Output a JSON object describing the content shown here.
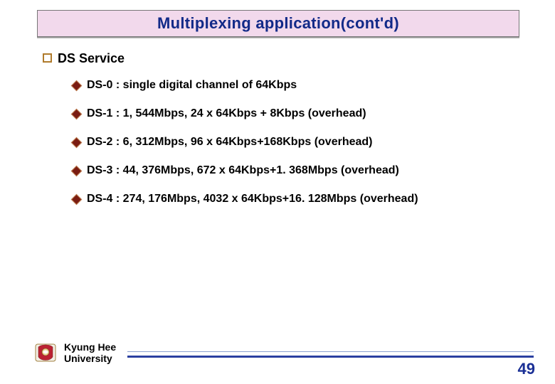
{
  "title": "Multiplexing application(cont'd)",
  "section": {
    "label": "DS Service"
  },
  "items": [
    {
      "text": "DS-0 : single digital channel of 64Kbps"
    },
    {
      "text": "DS-1 : 1, 544Mbps, 24 x 64Kbps + 8Kbps (overhead)"
    },
    {
      "text": "DS-2 : 6, 312Mbps, 96 x 64Kbps+168Kbps (overhead)"
    },
    {
      "text": "DS-3 : 44, 376Mbps, 672 x 64Kbps+1. 368Mbps (overhead)"
    },
    {
      "text": "DS-4 : 274, 176Mbps, 4032 x 64Kbps+16. 128Mbps (overhead)"
    }
  ],
  "footer": {
    "university_line1": "Kyung Hee",
    "university_line2": "University",
    "page": "49"
  }
}
